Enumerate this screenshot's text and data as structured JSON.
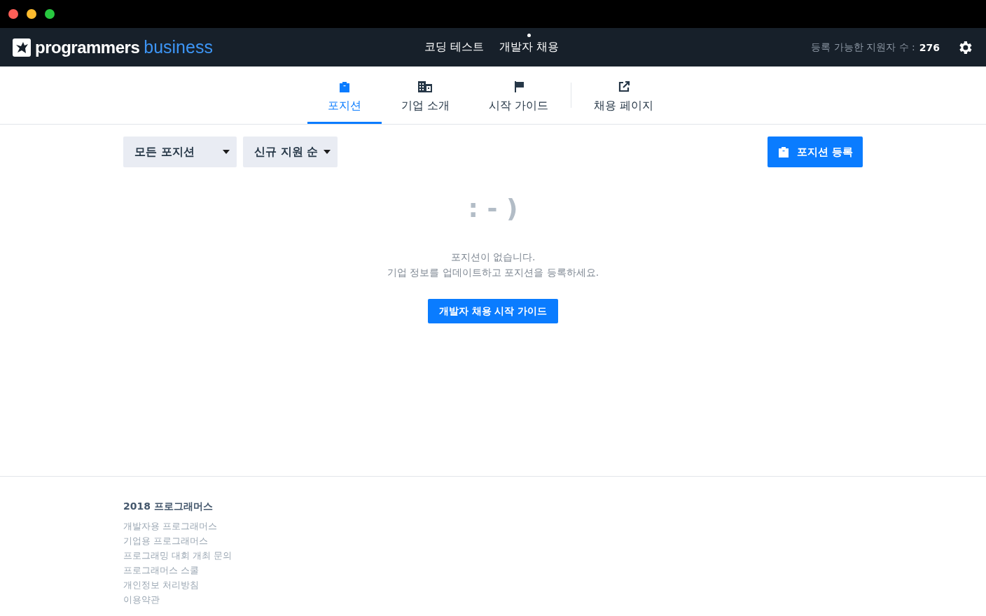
{
  "header": {
    "logo_main": "programmers",
    "logo_sub": "business",
    "nav": [
      {
        "label": "코딩 테스트",
        "selected": false
      },
      {
        "label": "개발자 채용",
        "selected": true
      }
    ],
    "applicants_label": "등록 가능한 지원자 수 :",
    "applicants_count": "276"
  },
  "tabs": [
    {
      "label": "포지션",
      "selected": true
    },
    {
      "label": "기업 소개",
      "selected": false
    },
    {
      "label": "시작 가이드",
      "selected": false
    },
    {
      "label": "채용 페이지",
      "selected": false
    }
  ],
  "filters": [
    "모든 포지션",
    "신규 지원 순"
  ],
  "register_button": "포지션 등록",
  "empty": {
    "emoticon": ": - )",
    "lines": [
      "포지션이 없습니다.",
      "기업 정보를 업데이트하고 포지션을 등록하세요."
    ],
    "button": "개발자 채용 시작 가이드"
  },
  "footer": {
    "title": "2018 프로그래머스",
    "links": [
      "개발자용 프로그래머스",
      "기업용 프로그래머스",
      "프로그래밍 대회 개최 문의",
      "프로그래머스 스쿨",
      "개인정보 처리방침",
      "이용약관"
    ]
  }
}
